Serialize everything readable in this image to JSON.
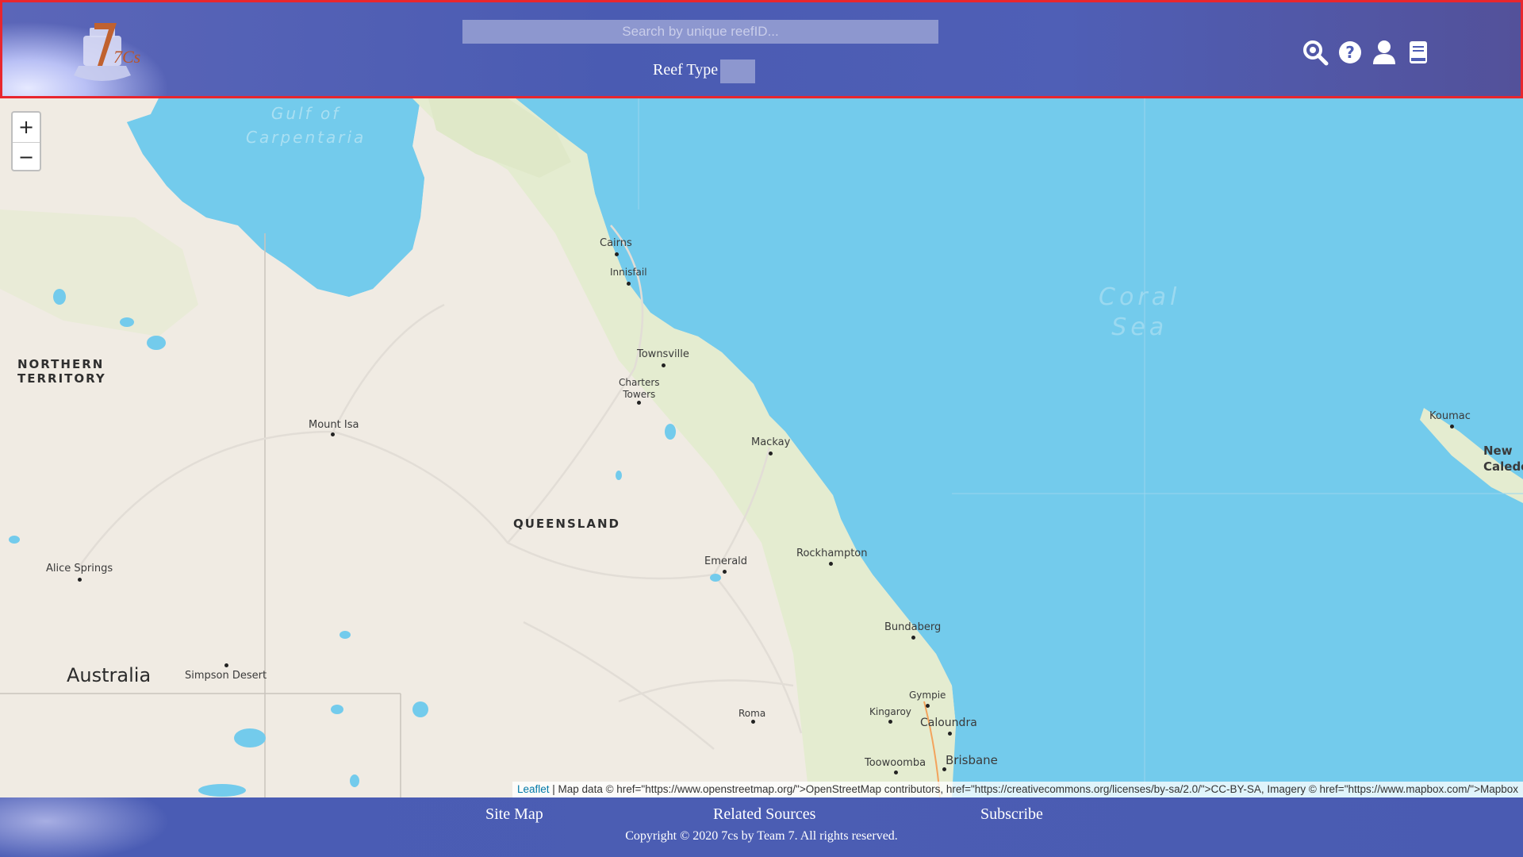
{
  "header": {
    "logo_text": "7Cs",
    "search_placeholder": "Search by unique reefID...",
    "reef_type_label": "Reef Type",
    "icons": [
      "search-icon",
      "help-icon",
      "user-icon",
      "book-icon"
    ]
  },
  "map": {
    "zoom_in": "+",
    "zoom_out": "−",
    "labels": {
      "gulf": "Gulf of\nCarpentaria",
      "coral_sea": "Coral\nSea",
      "northern_territory": "NORTHERN\nTERRITORY",
      "queensland": "QUEENSLAND",
      "australia": "Australia",
      "cairns": "Cairns",
      "innisfail": "Innisfail",
      "townsville": "Townsville",
      "charters_towers": "Charters\nTowers",
      "mount_isa": "Mount Isa",
      "mackay": "Mackay",
      "rockhampton": "Rockhampton",
      "emerald": "Emerald",
      "alice_springs": "Alice Springs",
      "simpson_desert": "Simpson Desert",
      "bundaberg": "Bundaberg",
      "gympie": "Gympie",
      "kingaroy": "Kingaroy",
      "caloundra": "Caloundra",
      "roma": "Roma",
      "toowoomba": "Toowoomba",
      "brisbane": "Brisbane",
      "koumac": "Koumac",
      "new_caledonia": "New\nCaledo"
    },
    "attribution_link": "Leaflet",
    "attribution_text": " | Map data © href=\"https://www.openstreetmap.org/\">OpenStreetMap contributors, href=\"https://creativecommons.org/licenses/by-sa/2.0/\">CC-BY-SA, Imagery © href=\"https://www.mapbox.com/\">Mapbox"
  },
  "footer": {
    "site_map": "Site Map",
    "related_sources": "Related Sources",
    "subscribe": "Subscribe",
    "copyright": "Copyright © 2020 7cs by Team 7. All rights reserved."
  },
  "colors": {
    "header_border": "#e8262e",
    "header_bg": "#4a5bb2",
    "sea": "#73cbec",
    "land": "#f0ebe3",
    "vegetation": "#e4ecd0"
  }
}
